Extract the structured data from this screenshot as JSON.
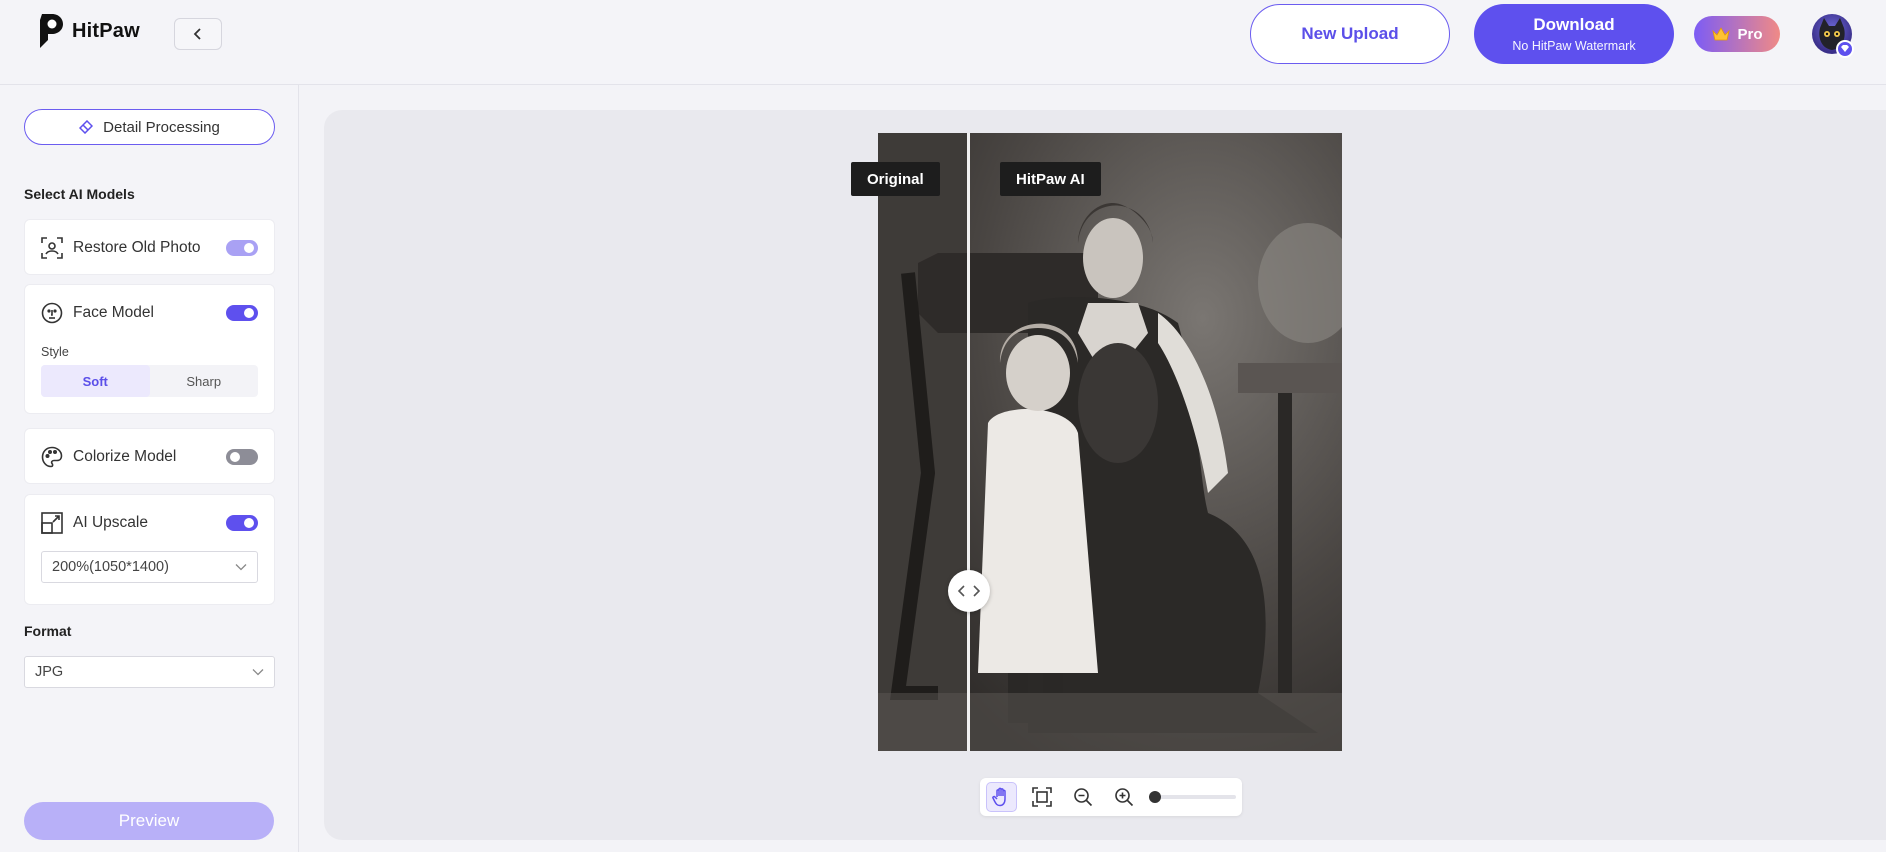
{
  "app": {
    "name": "HitPaw"
  },
  "header": {
    "new_upload_label": "New Upload",
    "download_label": "Download",
    "download_sub": "No HitPaw Watermark",
    "pro_label": "Pro"
  },
  "sidebar": {
    "detail_processing_label": "Detail Processing",
    "select_models_title": "Select AI Models",
    "models": [
      {
        "label": "Restore Old Photo",
        "enabled": true
      },
      {
        "label": "Face Model",
        "enabled": true
      },
      {
        "label": "Colorize Model",
        "enabled": false
      },
      {
        "label": "AI Upscale",
        "enabled": true
      }
    ],
    "style_label": "Style",
    "style_options": [
      "Soft",
      "Sharp"
    ],
    "style_selected": "Soft",
    "upscale_value": "200%(1050*1400)",
    "format_title": "Format",
    "format_value": "JPG",
    "preview_label": "Preview"
  },
  "canvas": {
    "original_tag": "Original",
    "ai_tag": "HitPaw AI"
  },
  "icons": {
    "back": "chevron-left-icon",
    "detail": "eraser-icon",
    "restore": "scan-face-icon",
    "face": "face-icon",
    "colorize": "palette-icon",
    "upscale": "upscale-icon",
    "pan": "hand-icon",
    "fit": "fit-screen-icon",
    "zoom_out": "zoom-out-icon",
    "zoom_in": "zoom-in-icon"
  },
  "colors": {
    "accent": "#5e50ee",
    "accent_light": "#a9a1f4"
  }
}
